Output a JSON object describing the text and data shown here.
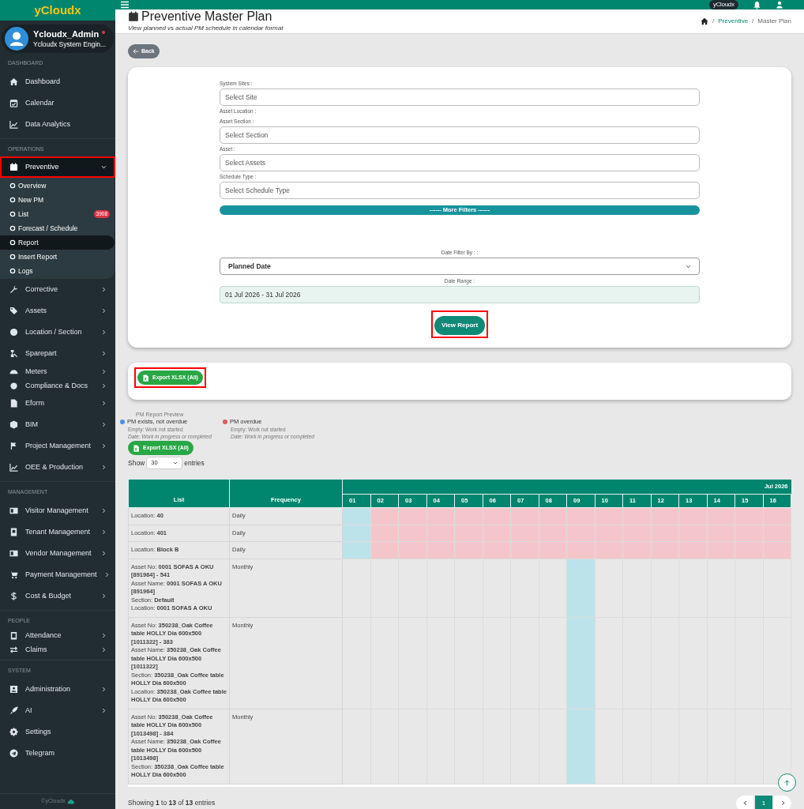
{
  "sidebar": {
    "logo": "yCloudx",
    "user": {
      "name": "Ycloudx_Admin",
      "role": "Ycloudx System Engin...",
      "online": true
    },
    "sections": [
      {
        "heading": "DASHBOARD",
        "items": [
          {
            "label": "Dashboard",
            "kind": "link",
            "outlined": false
          },
          {
            "label": "Calendar",
            "kind": "link",
            "outlined": false
          },
          {
            "label": "Data Analytics",
            "kind": "link",
            "outlined": false
          }
        ]
      },
      {
        "heading": "OPERATIONS",
        "items": [
          {
            "label": "Preventive",
            "kind": "group",
            "expanded": true,
            "outlined": true,
            "children": [
              {
                "label": "Overview",
                "selected": false
              },
              {
                "label": "New PM",
                "selected": false
              },
              {
                "label": "List",
                "selected": false,
                "badge": "3908"
              },
              {
                "label": "Forecast / Schedule",
                "selected": false
              },
              {
                "label": "Report",
                "selected": true
              },
              {
                "label": "Insert Report",
                "selected": false
              },
              {
                "label": "Logs",
                "selected": false
              }
            ]
          },
          {
            "label": "Corrective",
            "kind": "group",
            "expanded": false,
            "outlined": false
          },
          {
            "label": "Assets",
            "kind": "group",
            "expanded": false,
            "outlined": false
          },
          {
            "label": "Location / Section",
            "kind": "group",
            "expanded": false,
            "outlined": false
          },
          {
            "label": "Sparepart",
            "kind": "group",
            "expanded": false,
            "outlined": false
          },
          {
            "label": "Meters",
            "kind": "group",
            "expanded": false,
            "outlined": false,
            "tight": true
          },
          {
            "label": "Compliance & Docs",
            "kind": "group",
            "expanded": false,
            "outlined": false,
            "tight": true
          },
          {
            "label": "Eform",
            "kind": "group",
            "expanded": false,
            "outlined": false
          },
          {
            "label": "BIM",
            "kind": "group",
            "expanded": false,
            "outlined": false
          },
          {
            "label": "Project Management",
            "kind": "group",
            "expanded": false,
            "outlined": false
          },
          {
            "label": "OEE & Production",
            "kind": "group",
            "expanded": false,
            "outlined": false
          }
        ]
      },
      {
        "heading": "MANAGEMENT",
        "items": [
          {
            "label": "Visitor Management",
            "kind": "group",
            "expanded": false,
            "outlined": false
          },
          {
            "label": "Tenant Management",
            "kind": "group",
            "expanded": false,
            "outlined": false
          },
          {
            "label": "Vendor Management",
            "kind": "group",
            "expanded": false,
            "outlined": false
          },
          {
            "label": "Payment Management",
            "kind": "group",
            "expanded": false,
            "outlined": false
          },
          {
            "label": "Cost & Budget",
            "kind": "group",
            "expanded": false,
            "outlined": false
          }
        ]
      },
      {
        "heading": "PEOPLE",
        "items": [
          {
            "label": "Attendance",
            "kind": "group",
            "expanded": false,
            "outlined": false,
            "tight": true
          },
          {
            "label": "Claims",
            "kind": "group",
            "expanded": false,
            "outlined": false,
            "tight": true
          }
        ]
      },
      {
        "heading": "SYSTEM",
        "items": [
          {
            "label": "Administration",
            "kind": "group",
            "expanded": false,
            "outlined": false
          },
          {
            "label": "AI",
            "kind": "group",
            "expanded": false,
            "outlined": false
          },
          {
            "label": "Settings",
            "kind": "link",
            "outlined": false
          },
          {
            "label": "Telegram",
            "kind": "link",
            "outlined": false
          }
        ]
      }
    ],
    "footer": "©yCloudx"
  },
  "topbar": {
    "badge": "yCloudx"
  },
  "page": {
    "title": "Preventive Master Plan",
    "subtitle": "View planned vs actual PM schedule in calendar format",
    "breadcrumb": [
      {
        "separator": "/",
        "label": "Preventive",
        "kind": "link"
      },
      {
        "separator": "/",
        "label": "Master Plan",
        "kind": "current"
      }
    ]
  },
  "back_button": "Back",
  "filters": {
    "fields": [
      {
        "kind": "select",
        "label": "System Sites :",
        "placeholder": "Select Site"
      },
      {
        "kind": "label",
        "label": "Asset Location :"
      },
      {
        "kind": "select",
        "label": "Asset Section :",
        "placeholder": "Select Section"
      },
      {
        "kind": "select",
        "label": "Asset :",
        "placeholder": "Select Assets"
      },
      {
        "kind": "select",
        "label": "Schedule Type :",
        "placeholder": "Select Schedule Type"
      }
    ],
    "more_filters": "------ More Filters ------",
    "date_filter": {
      "label": "Date Filter By : :",
      "value": "Planned Date"
    },
    "date_range": {
      "label": "Date Range :",
      "value": "01 Jul 2026 - 31 Jul 2026"
    },
    "view_button": {
      "label": "View Report",
      "outlined": true
    }
  },
  "export_card": {
    "label": "Export XLSX (All)",
    "outlined": true
  },
  "legend": {
    "title": "PM Report Preview",
    "items": [
      {
        "label": "PM exists, not overdue",
        "color": "#4a8fe0",
        "notes": [
          "Empty: Work not started",
          "Date: Work in progress or completed"
        ]
      },
      {
        "label": "PM overdue",
        "color": "#e05a5a",
        "notes": [
          "Empty: Work not started",
          "Date: Work in progress or completed"
        ]
      }
    ]
  },
  "export_button": "Export XLSX (All)",
  "entries": {
    "prefix": "Show",
    "value": "30",
    "suffix": "entries"
  },
  "table": {
    "columns": [
      "List",
      "Frequency"
    ],
    "month": "Jul 2026",
    "days": [
      "01",
      "02",
      "03",
      "04",
      "05",
      "06",
      "07",
      "08",
      "09",
      "10",
      "11",
      "12",
      "13",
      "14",
      "15",
      "16"
    ],
    "rows": [
      {
        "list": [
          "Location: **40**"
        ],
        "frequency": "Daily",
        "cells": [
          {
            "color": "#bde3ea"
          },
          {
            "color": "#f4c6cc"
          },
          {
            "color": "#f4c6cc"
          },
          {
            "color": "#f4c6cc"
          },
          {
            "color": "#f4c6cc"
          },
          {
            "color": "#f4c6cc"
          },
          {
            "color": "#f4c6cc"
          },
          {
            "color": "#f4c6cc"
          },
          {
            "color": "#f4c6cc"
          },
          {
            "color": "#f4c6cc"
          },
          {
            "color": "#f4c6cc"
          },
          {
            "color": "#f4c6cc"
          },
          {
            "color": "#f4c6cc"
          },
          {
            "color": "#f4c6cc"
          },
          {
            "color": "#f4c6cc"
          },
          {
            "color": "#f4c6cc"
          }
        ]
      },
      {
        "list": [
          "Location: **401**"
        ],
        "frequency": "Daily",
        "cells": [
          {
            "color": "#bde3ea"
          },
          {
            "color": "#f4c6cc"
          },
          {
            "color": "#f4c6cc"
          },
          {
            "color": "#f4c6cc"
          },
          {
            "color": "#f4c6cc"
          },
          {
            "color": "#f4c6cc"
          },
          {
            "color": "#f4c6cc"
          },
          {
            "color": "#f4c6cc"
          },
          {
            "color": "#f4c6cc"
          },
          {
            "color": "#f4c6cc"
          },
          {
            "color": "#f4c6cc"
          },
          {
            "color": "#f4c6cc"
          },
          {
            "color": "#f4c6cc"
          },
          {
            "color": "#f4c6cc"
          },
          {
            "color": "#f4c6cc"
          },
          {
            "color": "#f4c6cc"
          }
        ]
      },
      {
        "list": [
          "Location: **Block B**"
        ],
        "frequency": "Daily",
        "cells": [
          {
            "color": "#bde3ea"
          },
          {
            "color": "#f4c6cc"
          },
          {
            "color": "#f4c6cc"
          },
          {
            "color": "#f4c6cc"
          },
          {
            "color": "#f4c6cc"
          },
          {
            "color": "#f4c6cc"
          },
          {
            "color": "#f4c6cc"
          },
          {
            "color": "#f4c6cc"
          },
          {
            "color": "#f4c6cc"
          },
          {
            "color": "#f4c6cc"
          },
          {
            "color": "#f4c6cc"
          },
          {
            "color": "#f4c6cc"
          },
          {
            "color": "#f4c6cc"
          },
          {
            "color": "#f4c6cc"
          },
          {
            "color": "#f4c6cc"
          },
          {
            "color": "#f4c6cc"
          }
        ]
      },
      {
        "list": [
          "Asset No: **0001 SOFAS A OKU [891964] - 541**",
          "Asset Name: **0001 SOFAS A OKU [891964]**",
          "Section: **Default**",
          "Location: **0001 SOFAS A OKU**"
        ],
        "frequency": "Monthly",
        "cells": [
          {
            "color": "#e8e8e8"
          },
          {
            "color": "#e8e8e8"
          },
          {
            "color": "#e8e8e8"
          },
          {
            "color": "#e8e8e8"
          },
          {
            "color": "#e8e8e8"
          },
          {
            "color": "#e8e8e8"
          },
          {
            "color": "#e8e8e8"
          },
          {
            "color": "#e8e8e8"
          },
          {
            "color": "#bde3ea"
          },
          {
            "color": "#e8e8e8"
          },
          {
            "color": "#e8e8e8"
          },
          {
            "color": "#e8e8e8"
          },
          {
            "color": "#e8e8e8"
          },
          {
            "color": "#e8e8e8"
          },
          {
            "color": "#e8e8e8"
          },
          {
            "color": "#e8e8e8"
          }
        ]
      },
      {
        "list": [
          "Asset No: **350238_Oak Coffee table HOLLY Dia 600x500 [1011322] - 383**",
          "Asset Name: **350238_Oak Coffee table HOLLY Dia 600x500 [1011322]**",
          "Section: **350238_Oak Coffee table HOLLY Dia 600x500**",
          "Location: **350238_Oak Coffee table HOLLY Dia 600x500**"
        ],
        "frequency": "Monthly",
        "cells": [
          {
            "color": "#e8e8e8"
          },
          {
            "color": "#e8e8e8"
          },
          {
            "color": "#e8e8e8"
          },
          {
            "color": "#e8e8e8"
          },
          {
            "color": "#e8e8e8"
          },
          {
            "color": "#e8e8e8"
          },
          {
            "color": "#e8e8e8"
          },
          {
            "color": "#e8e8e8"
          },
          {
            "color": "#bde3ea"
          },
          {
            "color": "#e8e8e8"
          },
          {
            "color": "#e8e8e8"
          },
          {
            "color": "#e8e8e8"
          },
          {
            "color": "#e8e8e8"
          },
          {
            "color": "#e8e8e8"
          },
          {
            "color": "#e8e8e8"
          },
          {
            "color": "#e8e8e8"
          }
        ]
      },
      {
        "list": [
          "Asset No: **350238_Oak Coffee table HOLLY Dia 600x500 [1013498] - 384**",
          "Asset Name: **350238_Oak Coffee table HOLLY Dia 600x500 [1013498]**",
          "Section: **350238_Oak Coffee table HOLLY Dia 600x500**"
        ],
        "frequency": "Monthly",
        "cells": [
          {
            "color": "#e8e8e8"
          },
          {
            "color": "#e8e8e8"
          },
          {
            "color": "#e8e8e8"
          },
          {
            "color": "#e8e8e8"
          },
          {
            "color": "#e8e8e8"
          },
          {
            "color": "#e8e8e8"
          },
          {
            "color": "#e8e8e8"
          },
          {
            "color": "#e8e8e8"
          },
          {
            "color": "#bde3ea"
          },
          {
            "color": "#e8e8e8"
          },
          {
            "color": "#e8e8e8"
          },
          {
            "color": "#e8e8e8"
          },
          {
            "color": "#e8e8e8"
          },
          {
            "color": "#e8e8e8"
          },
          {
            "color": "#e8e8e8"
          },
          {
            "color": "#e8e8e8"
          }
        ]
      }
    ]
  },
  "info": "Showing **1** to **13** of **13** entries",
  "pagination": [
    {
      "label": "1",
      "selected": true
    }
  ]
}
